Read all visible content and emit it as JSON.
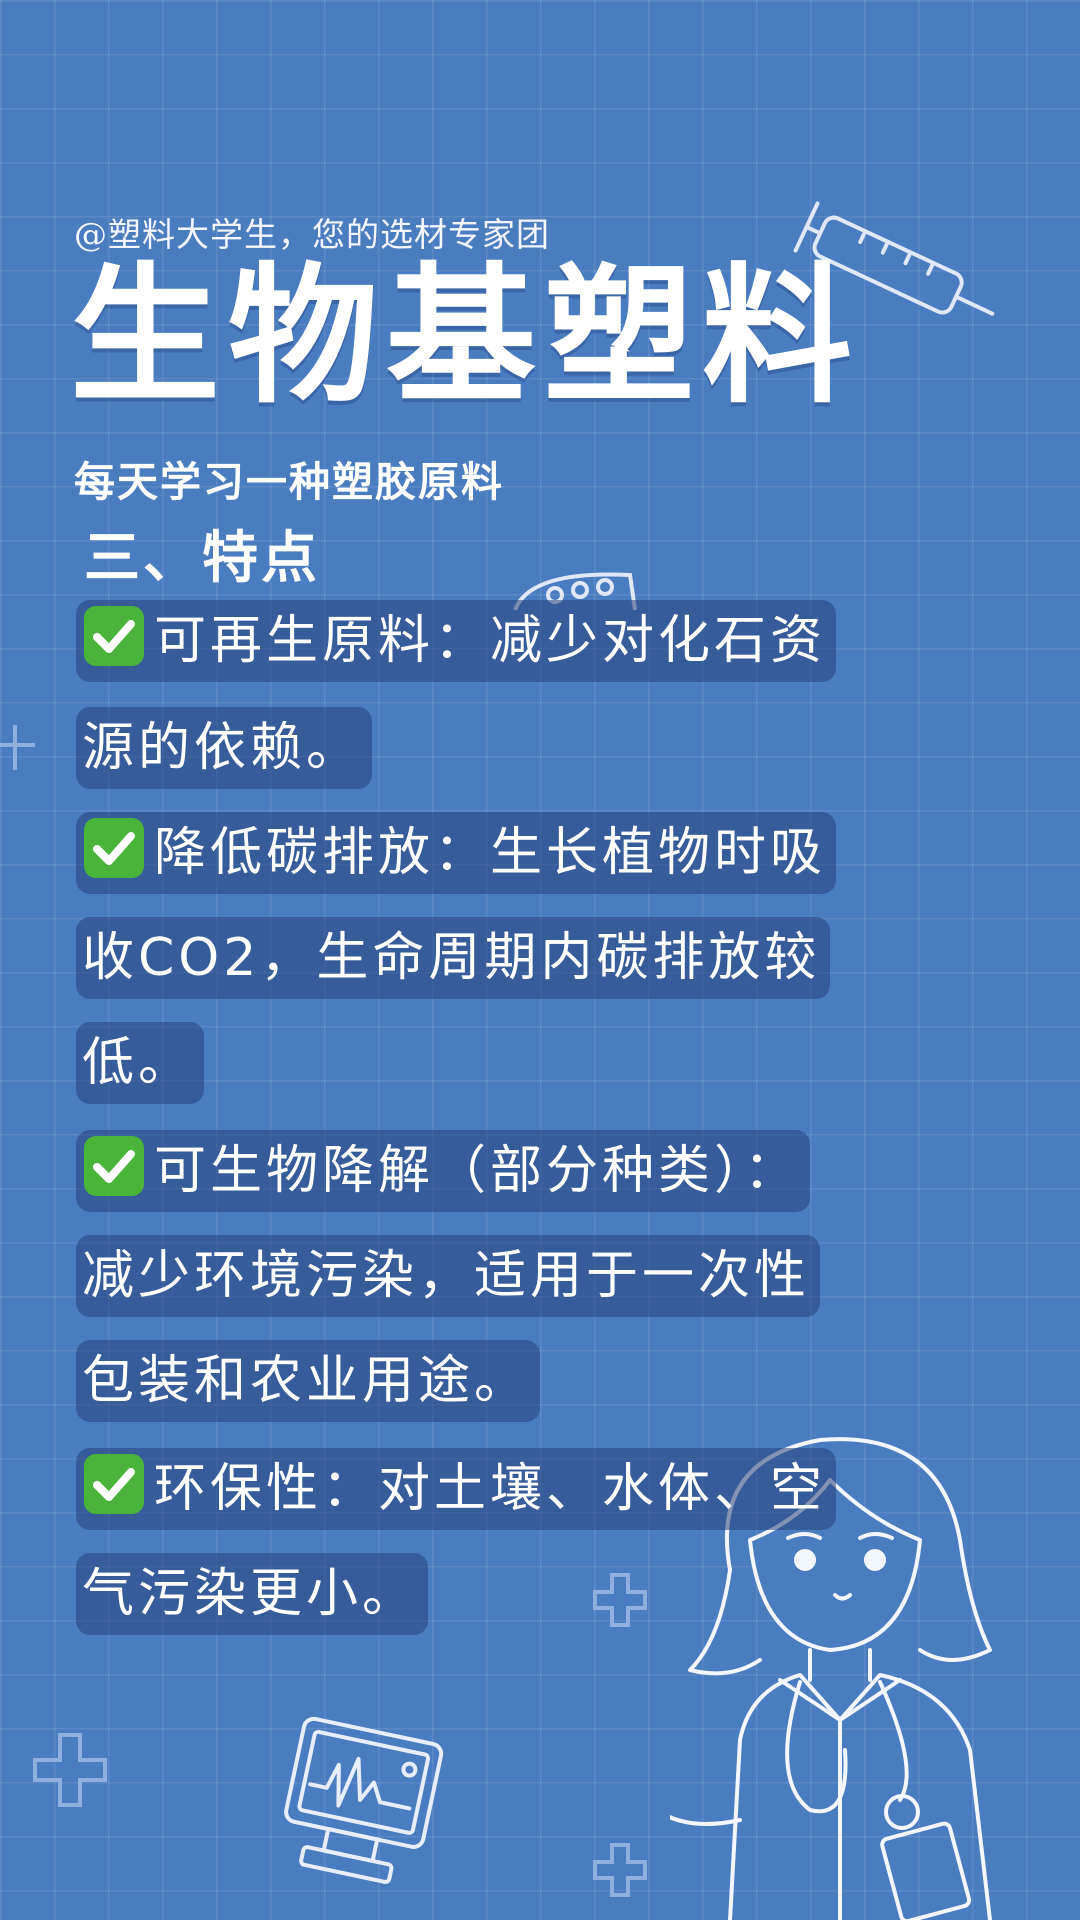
{
  "header": {
    "handle": "@塑料大学生，您的选材专家团",
    "title": "生物基塑料",
    "subtitle": "每天学习一种塑胶原料",
    "section": "三、特点"
  },
  "lines": [
    {
      "check": true,
      "text": "可再生原料：减少对化石资"
    },
    {
      "check": false,
      "text": "源的依赖。"
    },
    {
      "check": true,
      "text": "降低碳排放：生长植物时吸"
    },
    {
      "check": false,
      "text": "收CO2，生命周期内碳排放较"
    },
    {
      "check": false,
      "text": "低。"
    },
    {
      "check": true,
      "text": "可生物降解（部分种类）："
    },
    {
      "check": false,
      "text": "减少环境污染，适用于一次性"
    },
    {
      "check": false,
      "text": "包装和农业用途。"
    },
    {
      "check": true,
      "text": "环保性：对土壤、水体、空"
    },
    {
      "check": false,
      "text": "气污染更小。"
    }
  ],
  "icons": [
    "check-icon",
    "doctor-illustration",
    "monitor-illustration",
    "syringe-illustration",
    "pills-illustration",
    "plus-icon"
  ],
  "colors": {
    "background": "#4a7cc0",
    "check_green": "#49b33a",
    "text_box": "#2f5596"
  }
}
